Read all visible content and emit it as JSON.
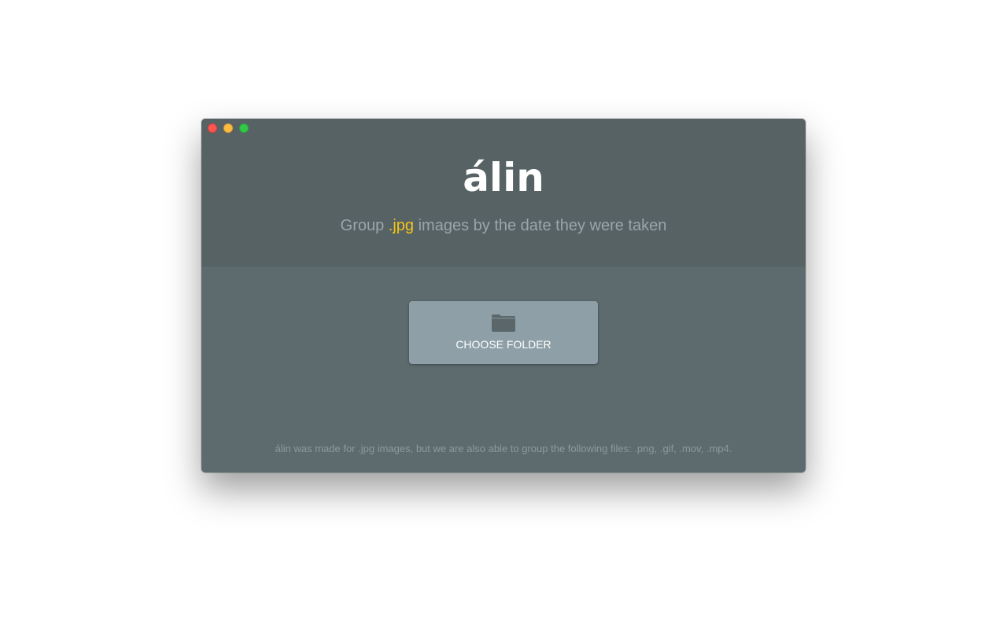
{
  "window": {
    "controls": {
      "close_icon": "close-icon",
      "minimize_icon": "minimize-icon",
      "maximize_icon": "maximize-icon"
    }
  },
  "header": {
    "logo": "álin",
    "tagline_before": "Group ",
    "tagline_ext": ".jpg",
    "tagline_after": " images by the date they were taken"
  },
  "main": {
    "choose_folder": {
      "icon": "folder-icon",
      "label": "CHOOSE FOLDER"
    },
    "footer_note": "álin was made for .jpg images, but we are also able to group the following files: .png, .gif, .mov, .mp4."
  },
  "colors": {
    "header_bg": "#566264",
    "body_bg": "#5d6a6e",
    "button_bg": "#8e9fa7",
    "accent": "#f5c518",
    "muted_text": "#9aa6a9"
  }
}
